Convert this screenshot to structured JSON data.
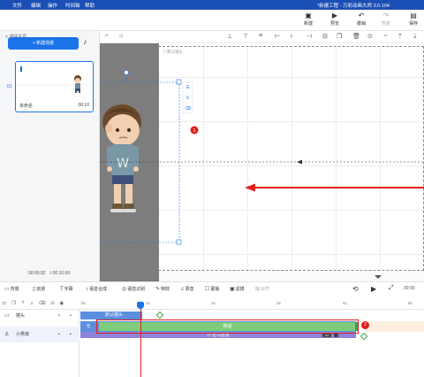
{
  "menu": {
    "items": [
      "文件",
      "编辑",
      "操作",
      "时间轴",
      "帮助"
    ],
    "title": "*新建工程 - 万彩动画大师 3.0.104"
  },
  "toolbar": {
    "new_label": "新建",
    "preview_label": "预览",
    "undo_label": "撤销",
    "redo_label": "恢复",
    "save_label": "保存"
  },
  "left_panel": {
    "back_label": "< 返回主页",
    "new_scene_label": "+ 新建场景",
    "scene": {
      "index": "01",
      "name": "未命名",
      "duration": "00:10"
    },
    "time_current": "00:00.92",
    "time_total": "/ 00:10.00"
  },
  "canvas": {
    "camera_label": "默认镜头",
    "badge_number": "1"
  },
  "timeline": {
    "tools": [
      {
        "icon": "▭",
        "label": "背景"
      },
      {
        "icon": "▯",
        "label": "前景"
      },
      {
        "icon": "T",
        "label": "字幕"
      },
      {
        "icon": "♪",
        "label": "语音合成"
      },
      {
        "icon": "◎",
        "label": "语音识别"
      },
      {
        "icon": "✎",
        "label": "特效"
      },
      {
        "icon": "♫",
        "label": "录音"
      },
      {
        "icon": "☐",
        "label": "蒙版"
      },
      {
        "icon": "▣",
        "label": "滤镜"
      },
      {
        "icon": "⊞",
        "label": "对齐"
      }
    ],
    "zoom_time": "00:00",
    "ruler_ticks": [
      "0s",
      "1s",
      "2s",
      "3s",
      "4s",
      "5s"
    ],
    "tracks": [
      {
        "name": "镜头"
      },
      {
        "name": "小男孩"
      }
    ],
    "camera_clip_label": "默认镜头",
    "enter_label": "无",
    "move_label": "移动",
    "exit_label": "⇄ 左-向左退",
    "badge_number": "2"
  },
  "colors": {
    "menubar": "#1a4fb5",
    "accent": "#1a73e8",
    "highlight_box": "#e0201b",
    "clip_green": "#7fcc7a",
    "clip_blue": "#5a8fe0",
    "clip_purple": "#8c84d9"
  }
}
